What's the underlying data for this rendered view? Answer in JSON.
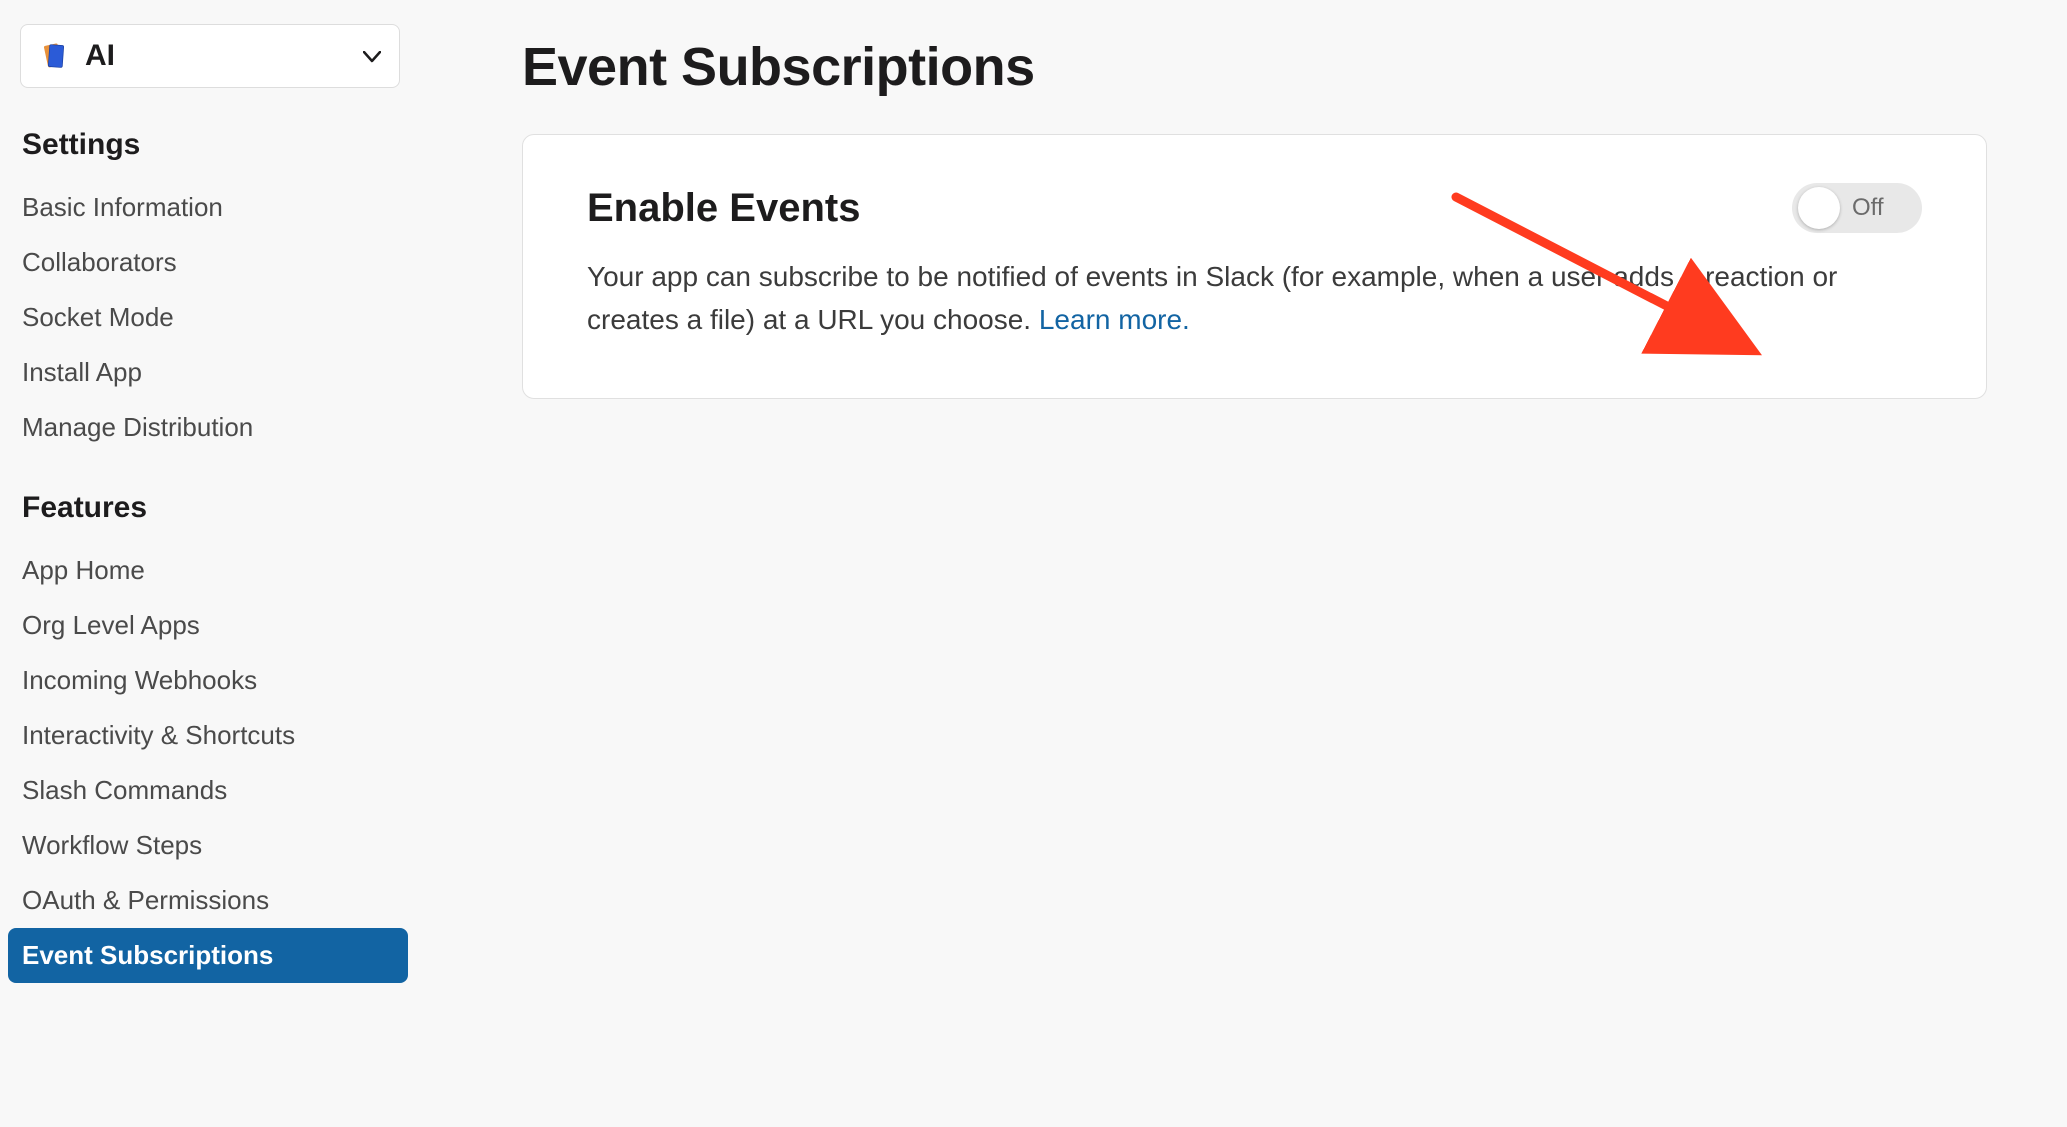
{
  "app_selector": {
    "name": "AI",
    "icon": "books-icon"
  },
  "sidebar": {
    "sections": [
      {
        "title": "Settings",
        "items": [
          {
            "label": "Basic Information",
            "slug": "basic-information",
            "active": false
          },
          {
            "label": "Collaborators",
            "slug": "collaborators",
            "active": false
          },
          {
            "label": "Socket Mode",
            "slug": "socket-mode",
            "active": false
          },
          {
            "label": "Install App",
            "slug": "install-app",
            "active": false
          },
          {
            "label": "Manage Distribution",
            "slug": "manage-distribution",
            "active": false
          }
        ]
      },
      {
        "title": "Features",
        "items": [
          {
            "label": "App Home",
            "slug": "app-home",
            "active": false
          },
          {
            "label": "Org Level Apps",
            "slug": "org-level-apps",
            "active": false
          },
          {
            "label": "Incoming Webhooks",
            "slug": "incoming-webhooks",
            "active": false
          },
          {
            "label": "Interactivity & Shortcuts",
            "slug": "interactivity-shortcuts",
            "active": false
          },
          {
            "label": "Slash Commands",
            "slug": "slash-commands",
            "active": false
          },
          {
            "label": "Workflow Steps",
            "slug": "workflow-steps",
            "active": false
          },
          {
            "label": "OAuth & Permissions",
            "slug": "oauth-permissions",
            "active": false
          },
          {
            "label": "Event Subscriptions",
            "slug": "event-subscriptions",
            "active": true
          }
        ]
      }
    ]
  },
  "main": {
    "title": "Event Subscriptions",
    "card": {
      "title": "Enable Events",
      "toggle": {
        "state": "off",
        "label": "Off"
      },
      "description": "Your app can subscribe to be notified of events in Slack (for example, when a user adds a reaction or creates a file) at a URL you choose. ",
      "learn_more": "Learn more."
    }
  },
  "annotation": {
    "type": "arrow",
    "color": "#ff3b1f"
  }
}
